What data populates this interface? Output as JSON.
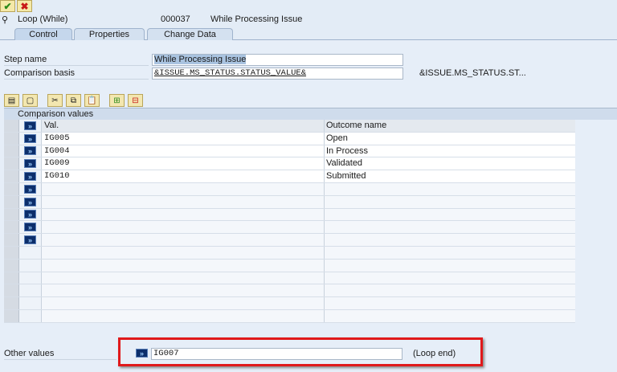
{
  "toolbar": {
    "confirm_icon": "check-icon",
    "cancel_icon": "cancel-icon"
  },
  "header": {
    "step_type": "Loop (While)",
    "step_number": "000037",
    "step_title": "While Processing Issue"
  },
  "tabs": [
    {
      "label": "Control"
    },
    {
      "label": "Properties"
    },
    {
      "label": "Change Data"
    }
  ],
  "form": {
    "step_name_label": "Step name",
    "step_name_value": "While Processing Issue",
    "comparison_basis_label": "Comparison basis",
    "comparison_basis_value": "&ISSUE.MS_STATUS.STATUS_VALUE&",
    "comparison_basis_desc": "&ISSUE.MS_STATUS.ST..."
  },
  "table": {
    "title": "Comparison values",
    "columns": [
      "Val.",
      "Outcome name"
    ],
    "rows": [
      {
        "val": "IG005",
        "outcome": "Open"
      },
      {
        "val": "IG004",
        "outcome": "In Process"
      },
      {
        "val": "IG009",
        "outcome": "Validated"
      },
      {
        "val": "IG010",
        "outcome": "Submitted"
      }
    ]
  },
  "other": {
    "label": "Other values",
    "value": "IG007",
    "desc": "(Loop end)"
  },
  "highlight_color": "#e0191b"
}
